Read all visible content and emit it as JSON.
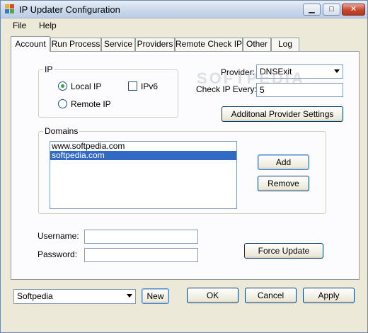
{
  "window": {
    "title": "IP Updater Configuration",
    "minimize_glyph": "▁",
    "maximize_glyph": "□",
    "close_glyph": "✕"
  },
  "menu": {
    "items": [
      "File",
      "Help"
    ]
  },
  "tabs": [
    "Account",
    "Run Process",
    "Service",
    "Providers",
    "Remote Check IP",
    "Other",
    "Log"
  ],
  "active_tab": "Account",
  "ip_group": {
    "label": "IP",
    "local_ip": "Local IP",
    "remote_ip": "Remote IP",
    "ipv6": "IPv6",
    "selected": "Local IP",
    "ipv6_checked": false
  },
  "provider": {
    "label": "Provider:",
    "value": "DNSExit",
    "check_ip_label": "Check IP Every:",
    "check_ip_value": "5",
    "settings_button": "Additonal Provider Settings"
  },
  "domains": {
    "label": "Domains",
    "items": [
      "www.softpedia.com",
      "softpedia.com"
    ],
    "selected_index": 1,
    "add_button": "Add",
    "remove_button": "Remove"
  },
  "credentials": {
    "username_label": "Username:",
    "username_value": "",
    "password_label": "Password:",
    "password_value": "",
    "force_update_button": "Force Update"
  },
  "footer": {
    "profile_value": "Softpedia",
    "new_button": "New",
    "ok_button": "OK",
    "cancel_button": "Cancel",
    "apply_button": "Apply"
  },
  "watermark": "SOFTPEDIA",
  "watermark_url": "www.softpedia.com",
  "colors": {
    "selection": "#316ac5",
    "radio_dot": "#3aa241",
    "close_button": "#c7472f"
  }
}
